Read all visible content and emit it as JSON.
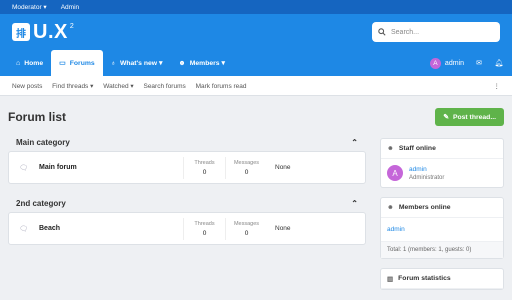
{
  "topbar": {
    "moderator": "Moderator ▾",
    "admin": "Admin"
  },
  "logo": {
    "mark": "排",
    "name": "U.X",
    "sup": "2"
  },
  "search": {
    "placeholder": "Search..."
  },
  "nav": {
    "tabs": [
      {
        "label": "Home",
        "icon": "home-icon"
      },
      {
        "label": "Forums",
        "icon": "comments-icon"
      },
      {
        "label": "What's new ▾",
        "icon": "lightbulb-icon"
      },
      {
        "label": "Members ▾",
        "icon": "users-icon"
      }
    ],
    "user": {
      "initial": "A",
      "name": "admin"
    }
  },
  "subnav": {
    "items": [
      "New posts",
      "Find threads ▾",
      "Watched ▾",
      "Search forums",
      "Mark forums read"
    ],
    "more": "⋮"
  },
  "page": {
    "title": "Forum list",
    "post_button": "Post thread..."
  },
  "categories": [
    {
      "title": "Main category",
      "forum": {
        "title": "Main forum",
        "threads_label": "Threads",
        "threads": "0",
        "messages_label": "Messages",
        "messages": "0",
        "last": "None"
      }
    },
    {
      "title": "2nd category",
      "forum": {
        "title": "Beach",
        "threads_label": "Threads",
        "threads": "0",
        "messages_label": "Messages",
        "messages": "0",
        "last": "None"
      }
    }
  ],
  "sidebar": {
    "staff": {
      "title": "Staff online",
      "user_initial": "A",
      "user_name": "admin",
      "role": "Administrator"
    },
    "members": {
      "title": "Members online",
      "user": "admin",
      "total": "Total: 1 (members: 1, guests: 0)"
    },
    "stats": {
      "title": "Forum statistics"
    }
  },
  "colors": {
    "brand": "#1e88e5",
    "topbar": "#1565c0",
    "post_button": "#5fb34a",
    "avatar": "#c566d9"
  }
}
